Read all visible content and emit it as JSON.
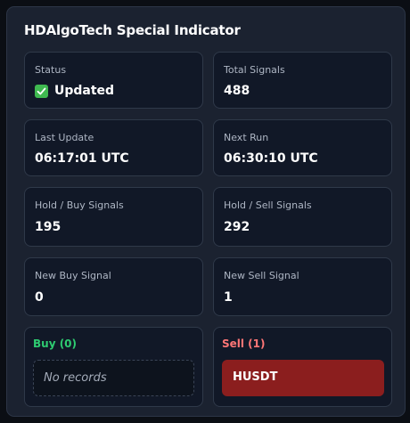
{
  "title": "HDAlgoTech Special Indicator",
  "colors": {
    "buy": "#2ecc71",
    "sell": "#ff7676",
    "sell_item_bg": "#8b1e1e",
    "status_ok": "#3fb950"
  },
  "stats": {
    "status": {
      "label": "Status",
      "value": "Updated",
      "icon": "check-icon"
    },
    "total_signals": {
      "label": "Total Signals",
      "value": "488"
    },
    "last_update": {
      "label": "Last Update",
      "value": "06:17:01 UTC"
    },
    "next_run": {
      "label": "Next Run",
      "value": "06:30:10 UTC"
    },
    "hold_buy": {
      "label": "Hold / Buy Signals",
      "value": "195"
    },
    "hold_sell": {
      "label": "Hold / Sell Signals",
      "value": "292"
    },
    "new_buy": {
      "label": "New Buy Signal",
      "value": "0"
    },
    "new_sell": {
      "label": "New Sell Signal",
      "value": "1"
    }
  },
  "buy_list": {
    "title": "Buy (0)",
    "empty_text": "No records"
  },
  "sell_list": {
    "title": "Sell (1)",
    "items": [
      "HUSDT"
    ]
  }
}
